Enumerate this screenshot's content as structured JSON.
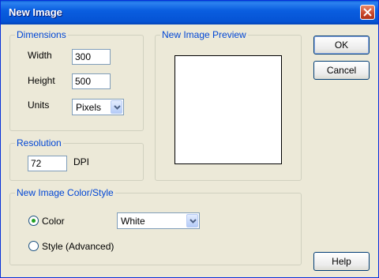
{
  "window": {
    "title": "New Image"
  },
  "dimensions": {
    "legend": "Dimensions",
    "width_label": "Width",
    "width_value": "300",
    "height_label": "Height",
    "height_value": "500",
    "units_label": "Units",
    "units_value": "Pixels"
  },
  "resolution": {
    "legend": "Resolution",
    "dpi_value": "72",
    "dpi_label": "DPI"
  },
  "preview": {
    "legend": "New Image Preview"
  },
  "color_style": {
    "legend": "New Image Color/Style",
    "color_label": "Color",
    "color_value": "White",
    "style_label": "Style (Advanced)",
    "selected": "color"
  },
  "buttons": {
    "ok": "OK",
    "cancel": "Cancel",
    "help": "Help"
  },
  "icons": {
    "close": "close-icon",
    "dropdown": "chevron-down-icon"
  },
  "colors": {
    "title_bar": "#0a5ee0",
    "group_label": "#0046d5",
    "close_button": "#c8452a"
  }
}
